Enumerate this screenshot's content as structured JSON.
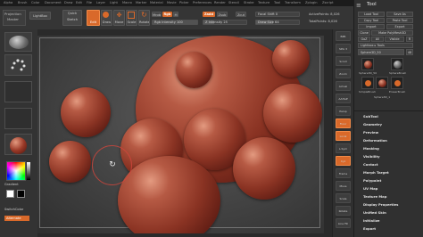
{
  "menu": {
    "items": [
      "Alpha",
      "Brush",
      "Color",
      "Document",
      "Draw",
      "Edit",
      "File",
      "Layer",
      "Light",
      "Macro",
      "Marker",
      "Material",
      "Movie",
      "Picker",
      "Preferences",
      "Render",
      "Stencil",
      "Stroke",
      "Texture",
      "Tool",
      "Transform",
      "Zplugin",
      "Zscript"
    ]
  },
  "top_shelf": {
    "brand_name": "Projection",
    "brand_sub": "Master",
    "lightbox_label": "LightBox",
    "quick_sketch_label": "Quick Sketch",
    "edit_label": "Edit",
    "draw_label": "Draw",
    "move_label": "Move",
    "scale_label": "Scale",
    "rotate_label": "Rotate",
    "mrgb_label": "Mrgb",
    "rgb_label": "Rgb",
    "m_label": "M",
    "rgb_intensity_label": "Rgb Intensity 100",
    "zadd_label": "Zadd",
    "zsub_label": "Zsub",
    "zcut_label": "Zcut",
    "z_intensity_label": "Z Intensity 25",
    "focal_shift_label": "Focal Shift 0",
    "draw_size_label": "Draw Size 64",
    "active_points_label": "ActivePoints: 8,026",
    "total_points_label": "TotalPoints: 8,026"
  },
  "left_shelf": {
    "standard_label": "Standard",
    "dots_label": "Dots",
    "alpha_off_label": "Alpha Off",
    "texture_off_label": "Texture Off",
    "matcap_label": "MatCap Red Wax",
    "gradient_label": "Gradient",
    "switch_color_label": "SwitchColor",
    "alternate_label": "Alternate",
    "accent_color": "#d9692a"
  },
  "canvas": {
    "frame_caption": "",
    "cursor_icon": "rotate-cursor-icon"
  },
  "right_toolbar": {
    "buttons": [
      "BPR",
      "SPix 3",
      "Scroll",
      "Zoom",
      "Actual",
      "AAHalf",
      "Persp",
      "Floor",
      "Local",
      "L.Sym",
      "Xyz",
      "Frame",
      "Move",
      "Scale",
      "Rotate",
      "Line Fill",
      "Transp",
      "Ghost",
      "Solo",
      "Xpose"
    ]
  },
  "tool_palette": {
    "title": "Tool",
    "load_tool": "Load Tool",
    "save_as": "Save As",
    "copy_tool": "Copy Tool",
    "paste_tool": "Paste Tool",
    "import": "Import",
    "export": "Export",
    "clone": "Clone",
    "make_polymesh": "Make PolyMesh3D",
    "goz": "GoZ",
    "all": "All",
    "visible": "Visible",
    "r": "R",
    "lightbox_tools": "Lightbox ▸ Tools",
    "current_tool": "Sphere3D_50",
    "current_tool_count": "48",
    "thumbnails": [
      "Sphere3D_50",
      "SphereBrush",
      "SimpleBrush",
      "Sphere3D_1",
      "EraserBrush"
    ],
    "subpalettes": [
      "SubTool",
      "Geometry",
      "Preview",
      "Deformation",
      "Masking",
      "Visibility",
      "Contact",
      "Morph Target",
      "Polypaint",
      "UV Map",
      "Texture Map",
      "Display Properties",
      "Unified Skin",
      "Initialize",
      "Export"
    ]
  },
  "colors": {
    "accent": "#d9692a",
    "sphere_base": "#8a3323",
    "background": "#262626"
  }
}
